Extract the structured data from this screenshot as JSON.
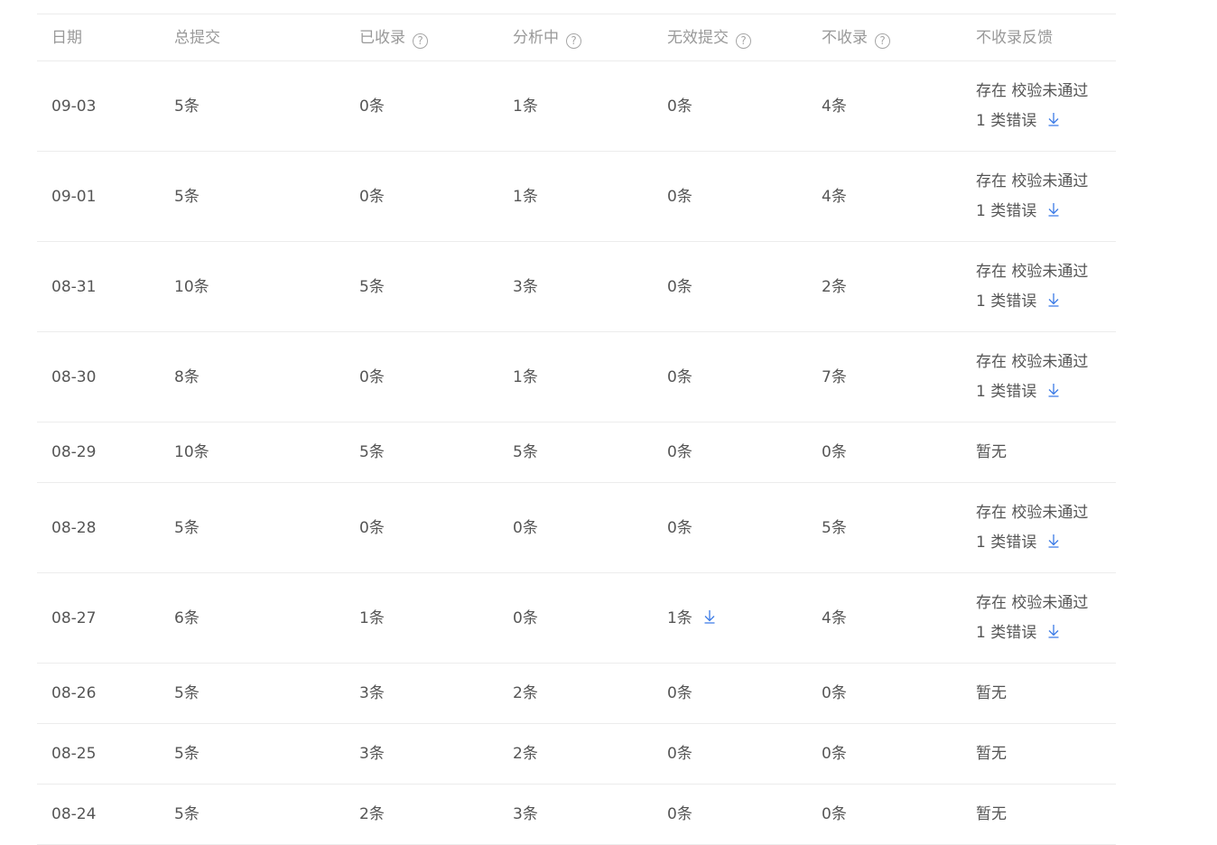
{
  "columns": {
    "date": "日期",
    "total": "总提交",
    "included": "已收录",
    "analyzing": "分析中",
    "invalid": "无效提交",
    "not_included": "不收录",
    "feedback": "不收录反馈",
    "help_glyph": "?"
  },
  "icons": {
    "help": "question-circle-icon",
    "download": "download-arrow-icon"
  },
  "colors": {
    "download_icon": "#3c7be6",
    "header_text": "#999999",
    "body_text": "#555555",
    "divider": "#ececec"
  },
  "rows": [
    {
      "date": "09-03",
      "total": "5条",
      "included": "0条",
      "analyzing": "1条",
      "invalid": "0条",
      "not_included": "4条",
      "feedback_line1": "存在 校验未通过",
      "feedback_line2": "1 类错误"
    },
    {
      "date": "09-01",
      "total": "5条",
      "included": "0条",
      "analyzing": "1条",
      "invalid": "0条",
      "not_included": "4条",
      "feedback_line1": "存在 校验未通过",
      "feedback_line2": "1 类错误"
    },
    {
      "date": "08-31",
      "total": "10条",
      "included": "5条",
      "analyzing": "3条",
      "invalid": "0条",
      "not_included": "2条",
      "feedback_line1": "存在 校验未通过",
      "feedback_line2": "1 类错误"
    },
    {
      "date": "08-30",
      "total": "8条",
      "included": "0条",
      "analyzing": "1条",
      "invalid": "0条",
      "not_included": "7条",
      "feedback_line1": "存在 校验未通过",
      "feedback_line2": "1 类错误"
    },
    {
      "date": "08-29",
      "total": "10条",
      "included": "5条",
      "analyzing": "5条",
      "invalid": "0条",
      "not_included": "0条",
      "feedback": "暂无"
    },
    {
      "date": "08-28",
      "total": "5条",
      "included": "0条",
      "analyzing": "0条",
      "invalid": "0条",
      "not_included": "5条",
      "feedback_line1": "存在 校验未通过",
      "feedback_line2": "1 类错误"
    },
    {
      "date": "08-27",
      "total": "6条",
      "included": "1条",
      "analyzing": "0条",
      "invalid": "1条",
      "not_included": "4条",
      "feedback_line1": "存在 校验未通过",
      "feedback_line2": "1 类错误"
    },
    {
      "date": "08-26",
      "total": "5条",
      "included": "3条",
      "analyzing": "2条",
      "invalid": "0条",
      "not_included": "0条",
      "feedback": "暂无"
    },
    {
      "date": "08-25",
      "total": "5条",
      "included": "3条",
      "analyzing": "2条",
      "invalid": "0条",
      "not_included": "0条",
      "feedback": "暂无"
    },
    {
      "date": "08-24",
      "total": "5条",
      "included": "2条",
      "analyzing": "3条",
      "invalid": "0条",
      "not_included": "0条",
      "feedback": "暂无"
    }
  ]
}
